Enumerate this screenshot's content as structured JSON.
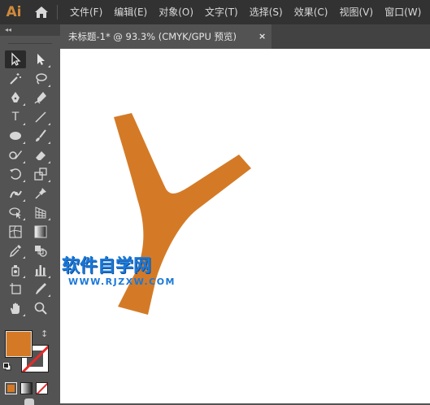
{
  "app": {
    "logo": "Ai"
  },
  "menu": [
    "文件(F)",
    "编辑(E)",
    "对象(O)",
    "文字(T)",
    "选择(S)",
    "效果(C)",
    "视图(V)",
    "窗口(W)"
  ],
  "panel": {
    "collapse_glyph": "◂◂"
  },
  "document": {
    "tab_title": "未标题-1* @ 93.3% (CMYK/GPU 预览)",
    "close_glyph": "×",
    "zoom": "93.3%",
    "color_mode": "CMYK/GPU 预览"
  },
  "colors": {
    "fill": "#d47a26",
    "artwork": "#d47a26",
    "stroke": "none",
    "watermark": "#1a78d8"
  },
  "tools": [
    {
      "name": "selection-tool",
      "icon": "arrow-icon"
    },
    {
      "name": "direct-selection-tool",
      "icon": "white-arrow-icon"
    },
    {
      "name": "magic-wand-tool",
      "icon": "magic-wand-icon"
    },
    {
      "name": "lasso-tool",
      "icon": "lasso-icon"
    },
    {
      "name": "pen-tool",
      "icon": "pen-icon"
    },
    {
      "name": "curvature-tool",
      "icon": "curvature-pen-icon"
    },
    {
      "name": "type-tool",
      "icon": "type-icon",
      "glyph": "T"
    },
    {
      "name": "line-tool",
      "icon": "line-icon"
    },
    {
      "name": "ellipse-tool",
      "icon": "ellipse-icon"
    },
    {
      "name": "paintbrush-tool",
      "icon": "brush-icon"
    },
    {
      "name": "shaper-tool",
      "icon": "shaper-icon"
    },
    {
      "name": "eraser-tool",
      "icon": "eraser-icon"
    },
    {
      "name": "rotate-tool",
      "icon": "rotate-icon"
    },
    {
      "name": "scale-tool",
      "icon": "scale-icon"
    },
    {
      "name": "puppet-warp-tool",
      "icon": "puppet-warp-icon"
    },
    {
      "name": "pin-tool",
      "icon": "pin-icon"
    },
    {
      "name": "shape-builder-tool",
      "icon": "shape-builder-icon"
    },
    {
      "name": "perspective-grid-tool",
      "icon": "perspective-grid-icon"
    },
    {
      "name": "mesh-tool",
      "icon": "mesh-icon"
    },
    {
      "name": "gradient-tool",
      "icon": "gradient-icon"
    },
    {
      "name": "eyedropper-tool",
      "icon": "eyedropper-icon"
    },
    {
      "name": "blend-tool",
      "icon": "blend-icon"
    },
    {
      "name": "symbol-sprayer-tool",
      "icon": "symbol-sprayer-icon"
    },
    {
      "name": "column-graph-tool",
      "icon": "graph-icon"
    },
    {
      "name": "artboard-tool",
      "icon": "artboard-icon"
    },
    {
      "name": "slice-tool",
      "icon": "slice-icon"
    },
    {
      "name": "hand-tool",
      "icon": "hand-icon"
    },
    {
      "name": "zoom-tool",
      "icon": "zoom-icon"
    }
  ],
  "swatches": {
    "swap_glyph": "↕"
  },
  "watermark": {
    "title": "软件自学网",
    "url": "WWW.RJZXW.COM"
  }
}
